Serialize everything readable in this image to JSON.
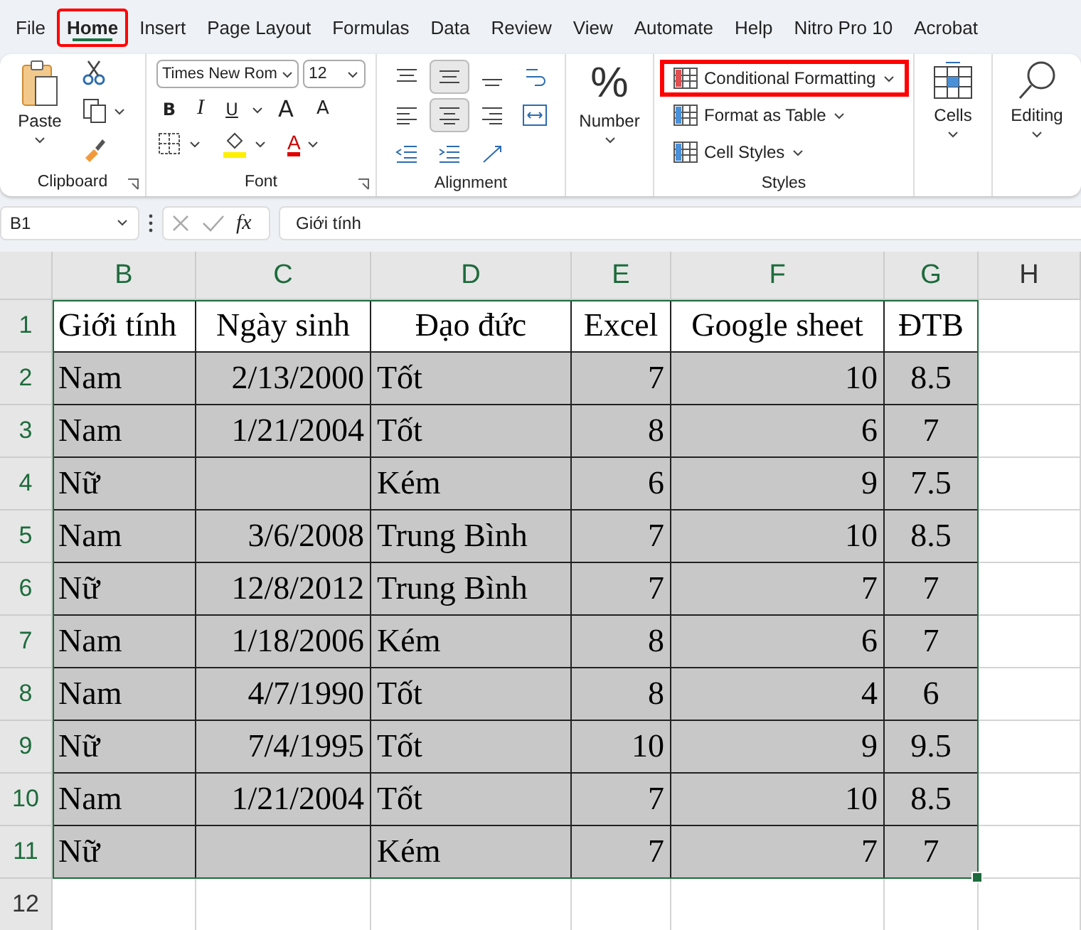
{
  "menu_tabs": [
    {
      "label": "File",
      "selected": false,
      "highlighted": false
    },
    {
      "label": "Home",
      "selected": true,
      "highlighted": true
    },
    {
      "label": "Insert",
      "selected": false,
      "highlighted": false
    },
    {
      "label": "Page Layout",
      "selected": false,
      "highlighted": false
    },
    {
      "label": "Formulas",
      "selected": false,
      "highlighted": false
    },
    {
      "label": "Data",
      "selected": false,
      "highlighted": false
    },
    {
      "label": "Review",
      "selected": false,
      "highlighted": false
    },
    {
      "label": "View",
      "selected": false,
      "highlighted": false
    },
    {
      "label": "Automate",
      "selected": false,
      "highlighted": false
    },
    {
      "label": "Help",
      "selected": false,
      "highlighted": false
    },
    {
      "label": "Nitro Pro 10",
      "selected": false,
      "highlighted": false
    },
    {
      "label": "Acrobat",
      "selected": false,
      "highlighted": false
    }
  ],
  "ribbon": {
    "clipboard": {
      "paste": "Paste",
      "label": "Clipboard"
    },
    "font": {
      "font_name": "Times New Rom",
      "font_size": "12",
      "bold": "B",
      "italic": "I",
      "underline": "U",
      "grow": "A",
      "shrink": "A",
      "font_color": "A",
      "label": "Font"
    },
    "alignment": {
      "label": "Alignment"
    },
    "number": {
      "icon": "%",
      "label": "Number"
    },
    "styles": {
      "items": [
        {
          "label": "Conditional Formatting",
          "highlighted": true
        },
        {
          "label": "Format as Table",
          "highlighted": false
        },
        {
          "label": "Cell Styles",
          "highlighted": false
        }
      ],
      "label": "Styles"
    },
    "cells": {
      "label": "Cells"
    },
    "editing": {
      "label": "Editing"
    }
  },
  "formula_bar": {
    "name_box": "B1",
    "fx": "fx",
    "value": "Giới tính"
  },
  "columns": [
    {
      "letter": "B",
      "selected": true,
      "kind": "text"
    },
    {
      "letter": "C",
      "selected": true,
      "kind": "number"
    },
    {
      "letter": "D",
      "selected": true,
      "kind": "text"
    },
    {
      "letter": "E",
      "selected": true,
      "kind": "number"
    },
    {
      "letter": "F",
      "selected": true,
      "kind": "number"
    },
    {
      "letter": "G",
      "selected": true,
      "kind": "average"
    },
    {
      "letter": "H",
      "selected": false,
      "kind": "text"
    }
  ],
  "rows": [
    {
      "number": "1",
      "selected": true,
      "kind": "header",
      "cells": [
        "Giới tính",
        "Ngày sinh",
        "Đạo đức",
        "Excel",
        "Google sheet",
        "ĐTB"
      ]
    },
    {
      "number": "2",
      "selected": true,
      "kind": "data",
      "cells": [
        "Nam",
        "2/13/2000",
        "Tốt",
        "7",
        "10",
        "8.5"
      ]
    },
    {
      "number": "3",
      "selected": true,
      "kind": "data",
      "cells": [
        "Nam",
        "1/21/2004",
        "Tốt",
        "8",
        "6",
        "7"
      ]
    },
    {
      "number": "4",
      "selected": true,
      "kind": "data",
      "cells": [
        "Nữ",
        null,
        "Kém",
        "6",
        "9",
        "7.5"
      ]
    },
    {
      "number": "5",
      "selected": true,
      "kind": "data",
      "cells": [
        "Nam",
        "3/6/2008",
        "Trung Bình",
        "7",
        "10",
        "8.5"
      ]
    },
    {
      "number": "6",
      "selected": true,
      "kind": "data",
      "cells": [
        "Nữ",
        "12/8/2012",
        "Trung Bình",
        "7",
        "7",
        "7"
      ]
    },
    {
      "number": "7",
      "selected": true,
      "kind": "data",
      "cells": [
        "Nam",
        "1/18/2006",
        "Kém",
        "8",
        "6",
        "7"
      ]
    },
    {
      "number": "8",
      "selected": true,
      "kind": "data",
      "cells": [
        "Nam",
        "4/7/1990",
        "Tốt",
        "8",
        "4",
        "6"
      ]
    },
    {
      "number": "9",
      "selected": true,
      "kind": "data",
      "cells": [
        "Nữ",
        "7/4/1995",
        "Tốt",
        "10",
        "9",
        "9.5"
      ]
    },
    {
      "number": "10",
      "selected": true,
      "kind": "data",
      "cells": [
        "Nam",
        "1/21/2004",
        "Tốt",
        "7",
        "10",
        "8.5"
      ]
    },
    {
      "number": "11",
      "selected": true,
      "kind": "data",
      "cells": [
        "Nữ",
        null,
        "Kém",
        "7",
        "7",
        "7"
      ]
    },
    {
      "number": "12",
      "selected": false,
      "kind": "empty",
      "cells": []
    }
  ]
}
